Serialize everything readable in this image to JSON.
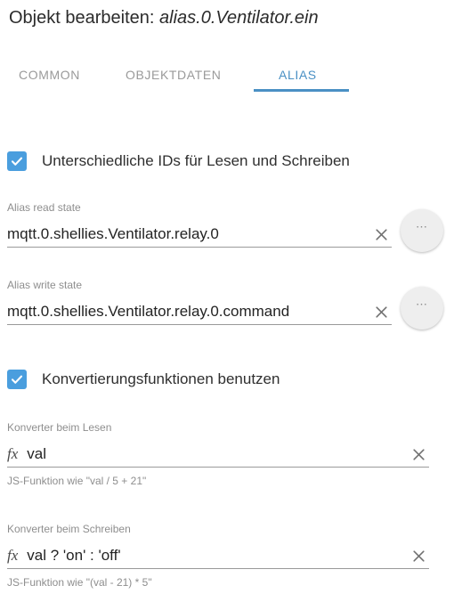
{
  "dialog": {
    "title_static": "Objekt bearbeiten:",
    "title_object": "alias.0.Ventilator.ein"
  },
  "tabs": {
    "items": [
      {
        "id": "common",
        "label": "COMMON",
        "active": false
      },
      {
        "id": "objektdaten",
        "label": "OBJEKTDATEN",
        "active": false
      },
      {
        "id": "alias",
        "label": "ALIAS",
        "active": true
      }
    ],
    "active_color": "#4a90c4",
    "inactive_color": "#9a9a9a"
  },
  "options": {
    "different_ids": {
      "label": "Unterschiedliche IDs für Lesen und Schreiben",
      "checked": true
    },
    "use_converters": {
      "label": "Konvertierungsfunktionen benutzen",
      "checked": true
    }
  },
  "fields": {
    "alias_read": {
      "label": "Alias read state",
      "value": "mqtt.0.shellies.Ventilator.relay.0",
      "clear_icon": "close-icon",
      "browse_icon": "ellipsis-icon"
    },
    "alias_write": {
      "label": "Alias write state",
      "value": "mqtt.0.shellies.Ventilator.relay.0.command",
      "clear_icon": "close-icon",
      "browse_icon": "ellipsis-icon"
    },
    "converter_read": {
      "label": "Konverter beim Lesen",
      "prefix_icon": "fx",
      "value": "val",
      "helper": "JS-Funktion wie \"val / 5 + 21\"",
      "clear_icon": "close-icon"
    },
    "converter_write": {
      "label": "Konverter beim Schreiben",
      "prefix_icon": "fx",
      "value": "val ? 'on' : 'off'",
      "helper": "JS-Funktion wie \"(val - 21) * 5\"",
      "clear_icon": "close-icon"
    }
  },
  "colors": {
    "accent": "#4a90c4",
    "checkbox": "#4a9ede",
    "fab_background": "#eeeeee",
    "label_text": "#8e8e8e",
    "body_text": "#232323"
  }
}
